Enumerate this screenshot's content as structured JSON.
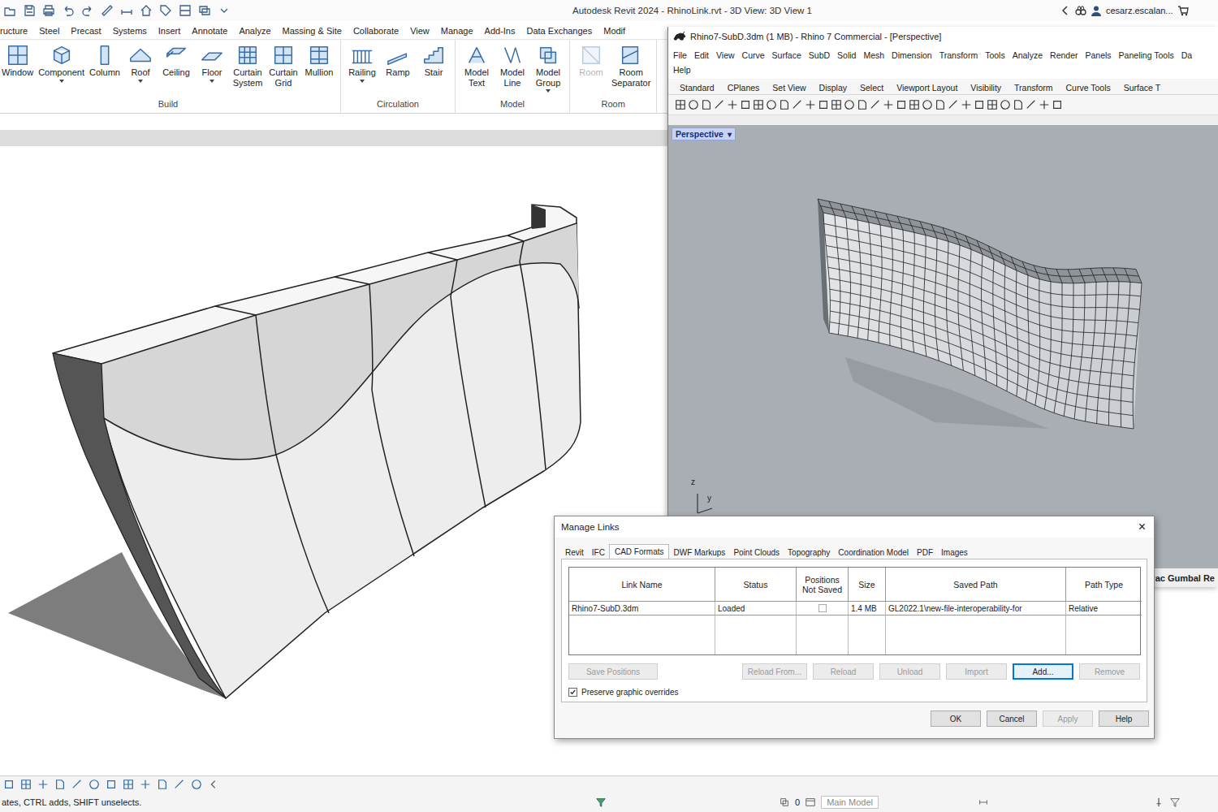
{
  "revit": {
    "title": "Autodesk Revit 2024 - RhinoLink.rvt - 3D View: 3D View 1",
    "user": "cesarz.escalan...",
    "tabs": [
      {
        "label": "ructure",
        "selected": false
      },
      {
        "label": "Steel",
        "selected": false
      },
      {
        "label": "Precast",
        "selected": false
      },
      {
        "label": "Systems",
        "selected": false
      },
      {
        "label": "Insert",
        "selected": false
      },
      {
        "label": "Annotate",
        "selected": false
      },
      {
        "label": "Analyze",
        "selected": false
      },
      {
        "label": "Massing & Site",
        "selected": false
      },
      {
        "label": "Collaborate",
        "selected": false
      },
      {
        "label": "View",
        "selected": false
      },
      {
        "label": "Manage",
        "selected": false
      },
      {
        "label": "Add-Ins",
        "selected": false
      },
      {
        "label": "Data Exchanges",
        "selected": false
      },
      {
        "label": "Modif",
        "selected": false
      }
    ],
    "panels": [
      {
        "label": "Build",
        "buttons": [
          {
            "label": "Window",
            "dropdown": false,
            "disabled": false
          },
          {
            "label": "Component",
            "dropdown": true,
            "disabled": false
          },
          {
            "label": "Column",
            "dropdown": false,
            "disabled": false
          },
          {
            "label": "Roof",
            "dropdown": true,
            "disabled": false
          },
          {
            "label": "Ceiling",
            "dropdown": false,
            "disabled": false
          },
          {
            "label": "Floor",
            "dropdown": true,
            "disabled": false
          },
          {
            "label": "Curtain System",
            "dropdown": false,
            "disabled": false
          },
          {
            "label": "Curtain Grid",
            "dropdown": false,
            "disabled": false
          },
          {
            "label": "Mullion",
            "dropdown": false,
            "disabled": false
          }
        ]
      },
      {
        "label": "Circulation",
        "buttons": [
          {
            "label": "Railing",
            "dropdown": true,
            "disabled": false
          },
          {
            "label": "Ramp",
            "dropdown": false,
            "disabled": false
          },
          {
            "label": "Stair",
            "dropdown": false,
            "disabled": false
          }
        ]
      },
      {
        "label": "Model",
        "buttons": [
          {
            "label": "Model Text",
            "dropdown": false,
            "disabled": false
          },
          {
            "label": "Model Line",
            "dropdown": false,
            "disabled": false
          },
          {
            "label": "Model Group",
            "dropdown": true,
            "disabled": false
          }
        ]
      },
      {
        "label": "Room",
        "buttons": [
          {
            "label": "Room",
            "dropdown": false,
            "disabled": true
          },
          {
            "label": "Room Separator",
            "dropdown": false,
            "disabled": false
          }
        ]
      }
    ],
    "status_hint": "ates, CTRL adds, SHIFT unselects.",
    "status_count": "0",
    "status_model": {
      "label": "Main Model",
      "disabled": true
    }
  },
  "rhino": {
    "title": "Rhino7-SubD.3dm (1 MB) - Rhino 7 Commercial - [Perspective]",
    "menu_rows": [
      [
        "File",
        "Edit",
        "View",
        "Curve",
        "Surface",
        "SubD",
        "Solid",
        "Mesh",
        "Dimension",
        "Transform",
        "Tools",
        "Analyze",
        "Render",
        "Panels",
        "Paneling Tools",
        "Da"
      ],
      [
        "Help"
      ]
    ],
    "toolbar_tabs": [
      {
        "label": "Standard",
        "selected": false
      },
      {
        "label": "CPlanes",
        "selected": false
      },
      {
        "label": "Set View",
        "selected": false
      },
      {
        "label": "Display",
        "selected": false
      },
      {
        "label": "Select",
        "selected": false
      },
      {
        "label": "Viewport Layout",
        "selected": false
      },
      {
        "label": "Visibility",
        "selected": false
      },
      {
        "label": "Transform",
        "selected": false
      },
      {
        "label": "Curve Tools",
        "selected": false
      },
      {
        "label": "Surface T",
        "selected": false
      }
    ],
    "viewport": {
      "label": "Perspective",
      "menu_arrow": "▾"
    },
    "axes": {
      "z": "z",
      "y": "y"
    },
    "status_right": "Trac Gumbal Re"
  },
  "dialog": {
    "title": "Manage Links",
    "close": "×",
    "tabs": [
      {
        "label": "Revit",
        "selected": false
      },
      {
        "label": "IFC",
        "selected": false
      },
      {
        "label": "CAD Formats",
        "selected": true
      },
      {
        "label": "DWF Markups",
        "selected": false
      },
      {
        "label": "Point Clouds",
        "selected": false
      },
      {
        "label": "Topography",
        "selected": false
      },
      {
        "label": "Coordination Model",
        "selected": false
      },
      {
        "label": "PDF",
        "selected": false
      },
      {
        "label": "Images",
        "selected": false
      }
    ],
    "columns": [
      "Link Name",
      "Status",
      "Positions Not Saved",
      "Size",
      "Saved Path",
      "Path Type"
    ],
    "rows": [
      {
        "link_name": "Rhino7-SubD.3dm",
        "status": "Loaded",
        "positions_not_saved": false,
        "size": "1.4 MB",
        "saved_path": "GL2022.1\\new-file-interoperability-for",
        "path_type": "Relative"
      }
    ],
    "buttons": [
      {
        "label": "Save Positions",
        "disabled": true,
        "selected": false
      },
      {
        "label": "Reload From...",
        "disabled": true,
        "selected": false
      },
      {
        "label": "Reload",
        "disabled": true,
        "selected": false
      },
      {
        "label": "Unload",
        "disabled": true,
        "selected": false
      },
      {
        "label": "Import",
        "disabled": true,
        "selected": false
      },
      {
        "label": "Add...",
        "disabled": false,
        "selected": true
      },
      {
        "label": "Remove",
        "disabled": true,
        "selected": false
      }
    ],
    "preserve": {
      "label": "Preserve graphic overrides",
      "checked": true
    },
    "footer_buttons": [
      {
        "label": "OK",
        "disabled": false
      },
      {
        "label": "Cancel",
        "disabled": false
      },
      {
        "label": "Apply",
        "disabled": true
      },
      {
        "label": "Help",
        "disabled": false
      }
    ]
  }
}
